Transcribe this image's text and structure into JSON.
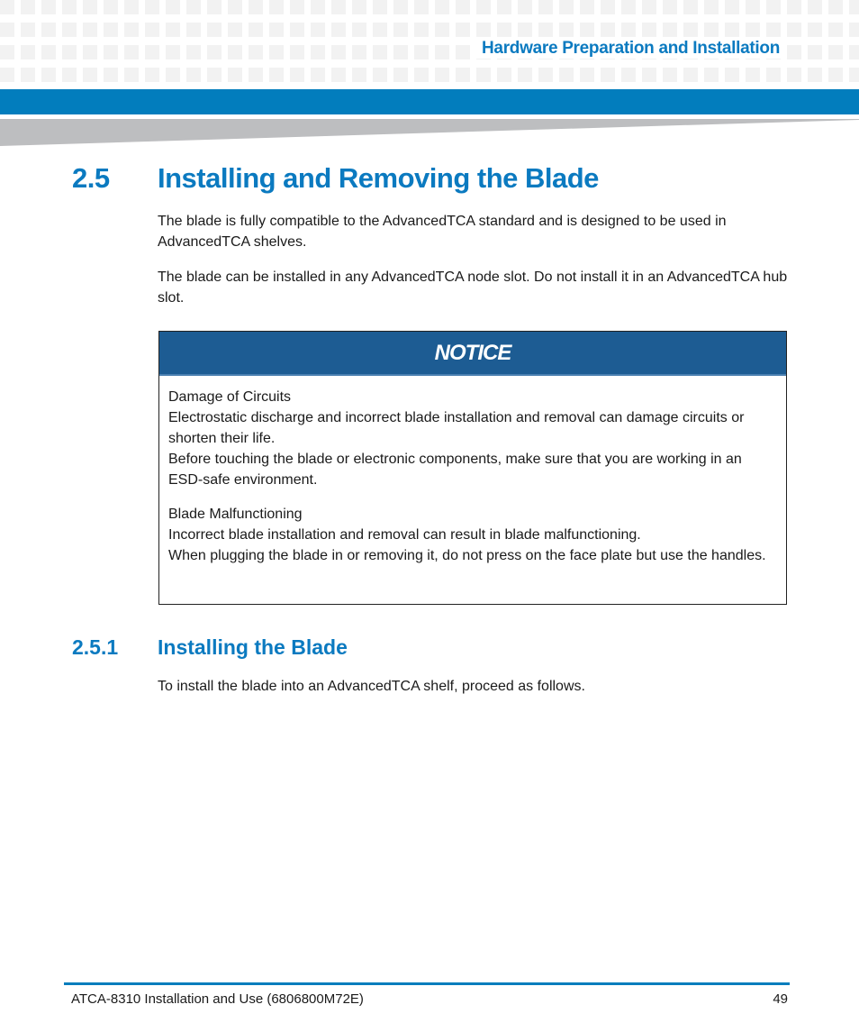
{
  "header": {
    "chapter_title": "Hardware Preparation and Installation",
    "accent_color": "#027dbd"
  },
  "section": {
    "number": "2.5",
    "title": "Installing and Removing the Blade",
    "paragraphs": [
      "The blade is fully compatible to the AdvancedTCA standard and is designed to be used in AdvancedTCA shelves.",
      "The blade can be installed in any AdvancedTCA node slot. Do not install it in an AdvancedTCA hub slot."
    ]
  },
  "notice": {
    "label": "NOTICE",
    "color": "#1d5c93",
    "blocks": [
      {
        "heading": "Damage of Circuits",
        "lines": [
          "Electrostatic discharge and incorrect blade installation and removal can damage circuits or shorten their life.",
          "Before touching the blade or electronic components, make sure that you are working in an ESD-safe environment."
        ]
      },
      {
        "heading": "Blade Malfunctioning",
        "lines": [
          "Incorrect blade installation and removal can result in blade malfunctioning.",
          "When plugging the blade in or removing it, do not press on the face plate but use the handles."
        ]
      }
    ]
  },
  "subsection": {
    "number": "2.5.1",
    "title": "Installing the Blade",
    "paragraph": "To install the blade into an AdvancedTCA shelf, proceed as follows."
  },
  "footer": {
    "document": "ATCA-8310 Installation and Use (6806800M72E)",
    "page_number": "49"
  }
}
